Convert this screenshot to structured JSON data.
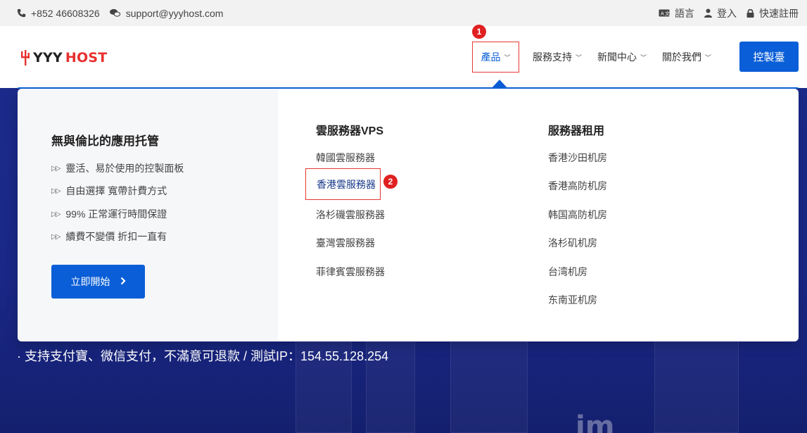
{
  "topbar": {
    "phone": "+852 46608326",
    "email": "support@yyyhost.com",
    "language": "語言",
    "login": "登入",
    "register": "快速註冊"
  },
  "header": {
    "logo_part1": "YYY",
    "logo_part2": "HOST",
    "nav": [
      {
        "label": "產品"
      },
      {
        "label": "服務支持"
      },
      {
        "label": "新聞中心"
      },
      {
        "label": "關於我們"
      }
    ],
    "console": "控製臺",
    "badge_1": "1"
  },
  "dropdown": {
    "intro_title": "無與倫比的應用托管",
    "features": [
      "靈活、易於使用的控製面板",
      "自由選擇 寬帶計費方式",
      "99% 正常運行時間保證",
      "續費不變價 折扣一直有"
    ],
    "start_button": "立即開始",
    "vps": {
      "title": "雲服務器VPS",
      "items": [
        "韓國雲服務器",
        "香港雲服務器",
        "洛杉磯雲服務器",
        "臺灣雲服務器",
        "菲律賓雲服務器"
      ]
    },
    "rental": {
      "title": "服務器租用",
      "items": [
        "香港沙田机房",
        "香港高防机房",
        "韩国高防机房",
        "洛杉矶机房",
        "台湾机房",
        "东南亚机房"
      ]
    },
    "badge_2": "2"
  },
  "hero": {
    "subtitle": "· 支持支付寶、微信支付，不滿意可退款 / 測試IP：154.55.128.254",
    "watermark": "im"
  },
  "colors": {
    "accent": "#0a5ed7",
    "highlight_border": "#e53935",
    "badge": "#e02020",
    "hero_bg": "#1b2a8a"
  }
}
